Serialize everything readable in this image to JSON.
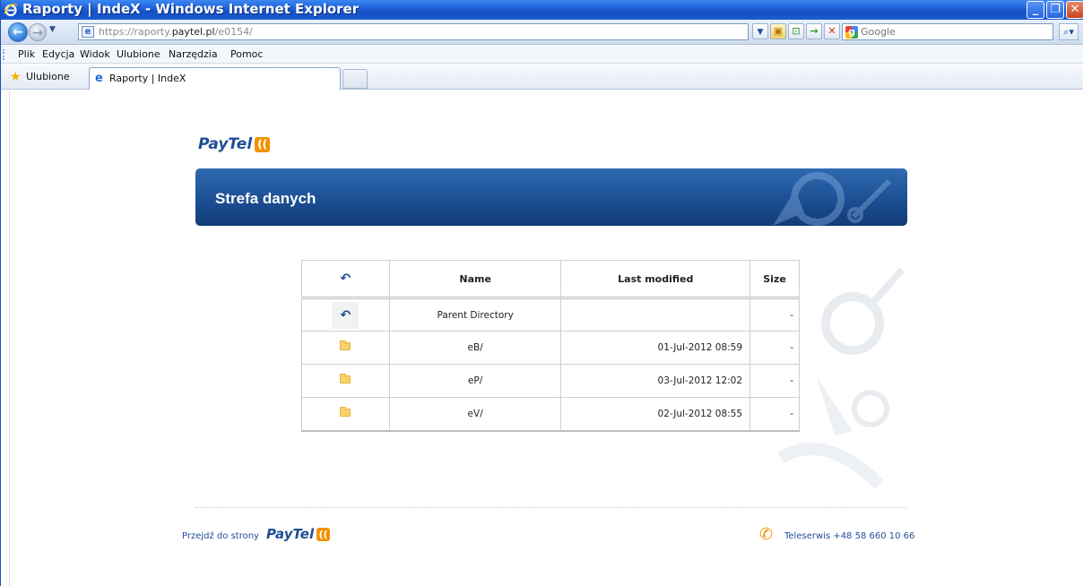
{
  "window": {
    "title": "Raporty | IndeX - Windows Internet Explorer",
    "controls": {
      "minimize": "_",
      "maximize": "❐",
      "close": "✕"
    }
  },
  "navbar": {
    "url_prefix": "https://raporty.",
    "url_host": "paytel.pl",
    "url_path": "/e0154/",
    "url_full": "https://raporty.paytel.pl/e0154/",
    "search_placeholder": "Google"
  },
  "menu": {
    "items": [
      "Plik",
      "Edycja",
      "Widok",
      "Ulubione",
      "Narzędzia",
      "Pomoc"
    ]
  },
  "favorites": {
    "label": "Ulubione",
    "tab_label": "Raporty | IndeX"
  },
  "page": {
    "logo_text": "PayTel",
    "banner_title": "Strefa danych",
    "table": {
      "headers": {
        "name": "Name",
        "modified": "Last modified",
        "size": "Size"
      },
      "rows": [
        {
          "icon": "back-icon",
          "name": "Parent Directory",
          "modified": "",
          "size": "-"
        },
        {
          "icon": "folder-icon",
          "name": "eB/",
          "modified": "01-Jul-2012 08:59",
          "size": "-"
        },
        {
          "icon": "folder-icon",
          "name": "eP/",
          "modified": "03-Jul-2012 12:02",
          "size": "-"
        },
        {
          "icon": "folder-icon",
          "name": "eV/",
          "modified": "02-Jul-2012 08:55",
          "size": "-"
        }
      ]
    },
    "footer": {
      "left_text": "Przejdź do strony",
      "right_text": "Teleserwis +48 58 660 10 66"
    }
  },
  "colors": {
    "brand_blue": "#1f4e96",
    "brand_orange": "#f39200",
    "titlebar_blue": "#1d5fd8"
  }
}
